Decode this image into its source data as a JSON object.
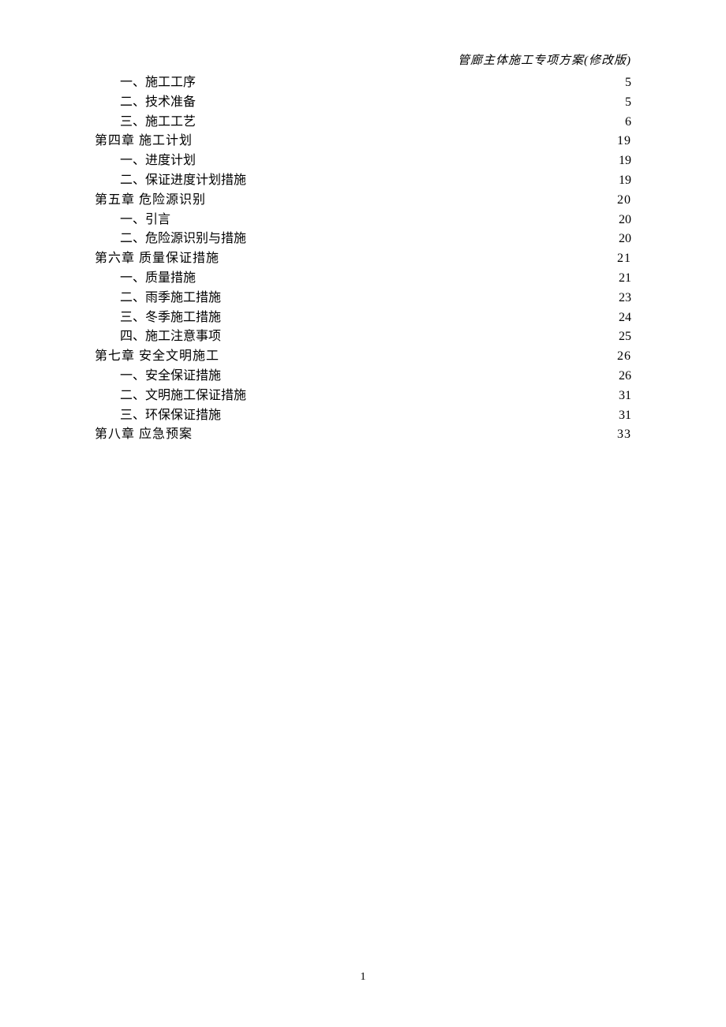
{
  "header": "管廊主体施工专项方案(修改版)",
  "page_number": "1",
  "toc": [
    {
      "level": 2,
      "label": "一、施工工序",
      "page": "5"
    },
    {
      "level": 2,
      "label": "二、技术准备",
      "page": "5"
    },
    {
      "level": 2,
      "label": "三、施工工艺",
      "page": "6"
    },
    {
      "level": 1,
      "label": "第四章 施工计划",
      "page": "19",
      "spaced_prefix": "第四章",
      "suffix": " 施工计划"
    },
    {
      "level": 2,
      "label": "一、进度计划",
      "page": "19"
    },
    {
      "level": 2,
      "label": "二、保证进度计划措施",
      "page": "19"
    },
    {
      "level": 1,
      "label": "第五章 危险源识别",
      "page": "20"
    },
    {
      "level": 2,
      "label": "一、引言",
      "page": "20"
    },
    {
      "level": 2,
      "label": "二、危险源识别与措施",
      "page": "20"
    },
    {
      "level": 1,
      "label": "第六章 质量保证措施",
      "page": "21"
    },
    {
      "level": 2,
      "label": "一、质量措施",
      "page": "21"
    },
    {
      "level": 2,
      "label": "二、雨季施工措施",
      "page": "23"
    },
    {
      "level": 2,
      "label": "三、冬季施工措施",
      "page": "24"
    },
    {
      "level": 2,
      "label": "四、施工注意事项",
      "page": "25"
    },
    {
      "level": 1,
      "label": "第七章 安全文明施工",
      "page": "26"
    },
    {
      "level": 2,
      "label": "一、安全保证措施",
      "page": "26"
    },
    {
      "level": 2,
      "label": "二、文明施工保证措施",
      "page": "31"
    },
    {
      "level": 2,
      "label": "三、环保保证措施",
      "page": "31"
    },
    {
      "level": 1,
      "label": "第八章 应急预案",
      "page": "33"
    }
  ]
}
